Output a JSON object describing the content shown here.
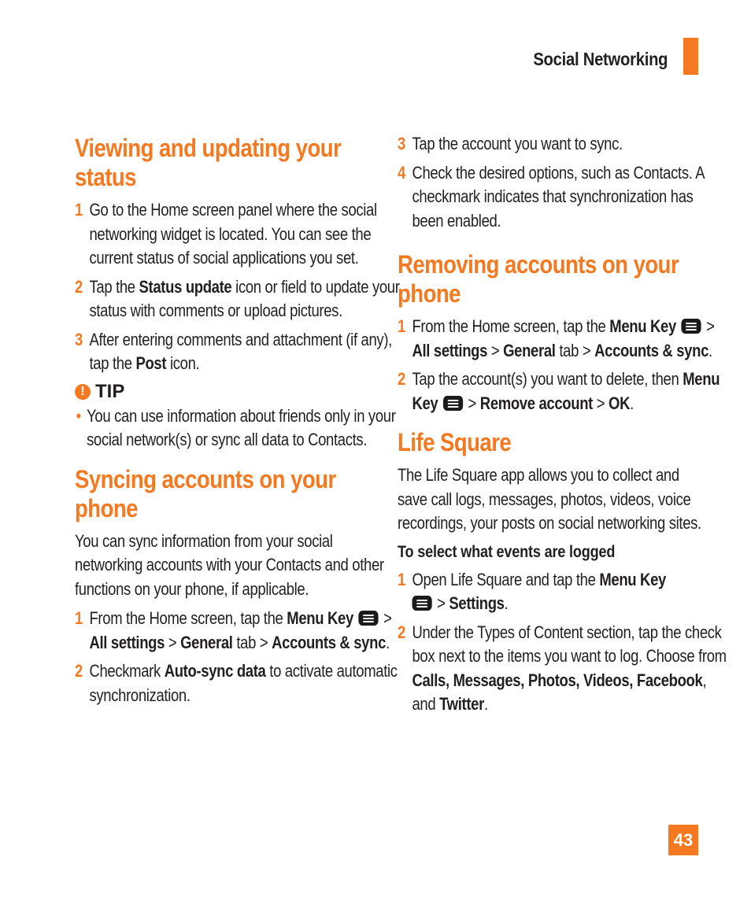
{
  "header": {
    "section_title": "Social Networking",
    "accent_color": "#f47920"
  },
  "page_number": "43",
  "left": {
    "viewing": {
      "heading_line1": "Viewing and updating your",
      "heading_line2": "status",
      "steps": [
        {
          "num": "1",
          "text": "Go to the Home screen panel where the social networking widget is located. You can see the current status of social applications you set."
        },
        {
          "num": "2",
          "pre": "Tap the ",
          "bold": "Status update",
          "post": " icon or field to update your status with comments or upload pictures."
        },
        {
          "num": "3",
          "pre": "After entering comments and attachment (if any), tap the ",
          "bold": "Post",
          "post": " icon."
        }
      ],
      "tip": {
        "icon": "!",
        "label": "TIP",
        "bullet": "•",
        "text": "You can use information about friends only in your social network(s) or sync all data to Contacts."
      }
    },
    "syncing": {
      "heading_line1": "Syncing accounts on your",
      "heading_line2": "phone",
      "intro": "You can sync information from your social networking accounts with your Contacts and other functions on your phone, if applicable.",
      "step1": {
        "num": "1",
        "pre": "From the Home screen, tap the ",
        "b1": "Menu Key",
        "sep1": " > ",
        "b2": "All settings",
        "sep2": "  > ",
        "b3": "General",
        "mid": " tab > ",
        "b4": "Accounts & sync",
        "end": "."
      },
      "step2": {
        "num": "2",
        "pre": "Checkmark ",
        "bold": "Auto-sync data",
        "post": " to activate automatic synchronization."
      }
    }
  },
  "right": {
    "sync_cont": {
      "step3": {
        "num": "3",
        "text": "Tap the account you want to sync."
      },
      "step4": {
        "num": "4",
        "text": "Check the desired options, such as Contacts. A checkmark indicates that synchronization has been enabled."
      }
    },
    "removing": {
      "heading_line1": "Removing accounts on your",
      "heading_line2": "phone",
      "step1": {
        "num": "1",
        "pre": "From the Home screen, tap the ",
        "b1": "Menu Key",
        "sep1": " > ",
        "b2": "All settings",
        "sep2": "  > ",
        "b3": "General",
        "mid": " tab > ",
        "b4": "Accounts & sync",
        "end": "."
      },
      "step2": {
        "num": "2",
        "pre": "Tap the account(s) you want to delete, then ",
        "b1": "Menu Key",
        "sep1": " > ",
        "b2": "Remove account",
        "sep2": " > ",
        "b3": "OK",
        "end": "."
      }
    },
    "life_square": {
      "heading": "Life Square",
      "intro": "The Life Square app allows you to collect and save call logs, messages, photos, videos, voice recordings, your posts on social networking sites.",
      "subheading": "To select what events are logged",
      "step1": {
        "num": "1",
        "pre": "Open Life Square and tap the ",
        "b1": "Menu Key",
        "sep1": " > ",
        "b2": "Settings",
        "end": "."
      },
      "step2": {
        "num": "2",
        "pre": "Under the Types of Content section, tap the check box next to the items you want to log. Choose from ",
        "b1": "Calls, Messages, Photos, Videos, Facebook",
        "mid": ", and ",
        "b2": "Twitter",
        "end": "."
      }
    }
  }
}
